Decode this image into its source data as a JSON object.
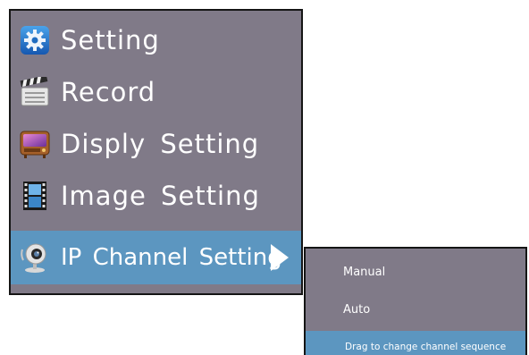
{
  "main_menu": {
    "items": [
      {
        "label": "Setting",
        "icon": "gear-icon"
      },
      {
        "label": "Record",
        "icon": "clapperboard-icon"
      },
      {
        "label": "Disply Setting",
        "icon": "tv-icon"
      },
      {
        "label": "Image Setting",
        "icon": "film-strip-icon"
      },
      {
        "label": "IP Channel Setting",
        "icon": "webcam-icon",
        "selected": true,
        "has_submenu": true
      }
    ]
  },
  "sub_menu": {
    "items": [
      {
        "label": "Manual"
      },
      {
        "label": "Auto"
      },
      {
        "label": "Drag to change channel sequence",
        "highlighted": true
      }
    ]
  },
  "colors": {
    "panel_bg": "#807a88",
    "selected_bg": "#5c96c0",
    "border": "#151515",
    "text": "#ffffff"
  }
}
